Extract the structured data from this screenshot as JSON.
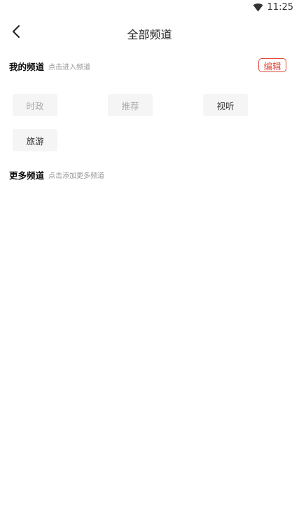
{
  "status_bar": {
    "time": "11:25",
    "wifi_icon": "wifi-icon"
  },
  "header": {
    "back_icon": "chevron-left-icon",
    "title": "全部频道"
  },
  "my_channels": {
    "title": "我的频道",
    "hint": "点击进入频道",
    "edit_label": "编辑",
    "items": [
      {
        "label": "时政",
        "state": "fixed"
      },
      {
        "label": "推荐",
        "state": "fixed"
      },
      {
        "label": "视听",
        "state": "normal"
      },
      {
        "label": "旅游",
        "state": "normal"
      }
    ]
  },
  "more_channels": {
    "title": "更多频道",
    "hint": "点击添加更多频道"
  },
  "colors": {
    "accent": "#e0483a",
    "chip_bg": "#f5f5f5",
    "hint_text": "#999999"
  }
}
